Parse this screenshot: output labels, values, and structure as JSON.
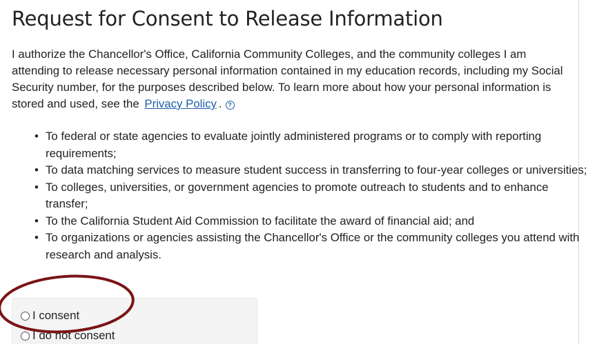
{
  "page": {
    "title": "Request for Consent to Release Information"
  },
  "intro": {
    "text_before_link": "I authorize the Chancellor's Office, California Community Colleges, and the community colleges I am attending to release necessary personal information contained in my education records, including my Social Security number, for the purposes described below. To learn more about how your personal information is stored and used, see the",
    "link_label": "Privacy Policy",
    "text_after_link": ".",
    "help_icon": "help-circle-icon",
    "help_glyph": "?"
  },
  "purposes": [
    "To federal or state agencies to evaluate jointly administered programs or to comply with reporting requirements;",
    "To data matching services to measure student success in transferring to four-year colleges or universities;",
    "To colleges, universities, or government agencies to promote outreach to students and to enhance transfer;",
    "To the California Student Aid Commission to facilitate the award of financial aid; and",
    "To organizations or agencies assisting the Chancellor's Office or the community colleges you attend with research and analysis."
  ],
  "consent": {
    "options": [
      {
        "label": "I consent",
        "selected": false
      },
      {
        "label": "I do not consent",
        "selected": false
      }
    ]
  },
  "colors": {
    "link": "#1d5fa8",
    "text": "#222222",
    "annotation_circle": "#7a1416",
    "consent_box_bg": "#f4f4f4"
  }
}
